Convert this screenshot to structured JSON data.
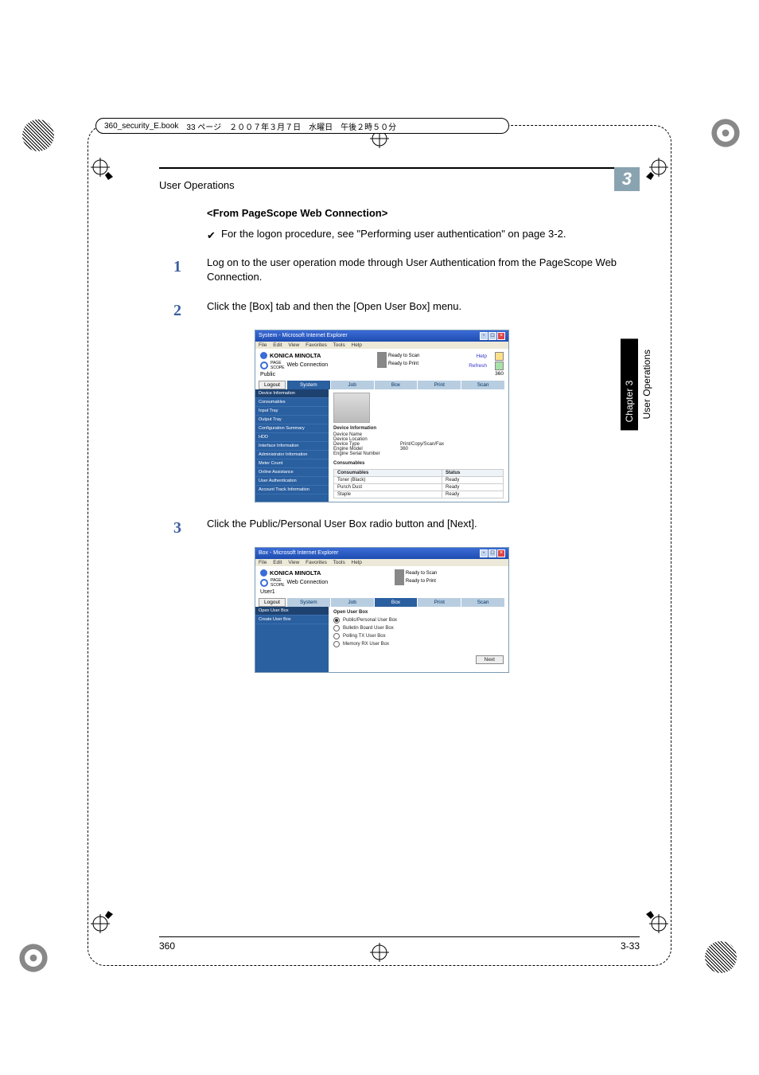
{
  "meta_oval": {
    "filename": "360_security_E.book",
    "page_label": "33 ページ",
    "date": "２００７年３月７日　水曜日　午後２時５０分"
  },
  "chapter": {
    "title": "User Operations",
    "number": "3"
  },
  "section_heading": "<From PageScope Web Connection>",
  "note_text": "For the logon procedure, see \"Performing user authentication\" on page 3-2.",
  "steps": [
    {
      "n": "1",
      "text": "Log on to the user operation mode through User Authentication from the PageScope Web Connection."
    },
    {
      "n": "2",
      "text": "Click the [Box] tab and then the [Open User Box] menu."
    },
    {
      "n": "3",
      "text": "Click the Public/Personal User Box radio button and [Next]."
    }
  ],
  "sidetab": {
    "black": "Chapter 3",
    "plain": "User Operations"
  },
  "footer": {
    "left": "360",
    "right": "3-33"
  },
  "screenshot1": {
    "title": "System - Microsoft Internet Explorer",
    "menus": [
      "File",
      "Edit",
      "View",
      "Favorites",
      "Tools",
      "Help"
    ],
    "brand": "KONICA MINOLTA",
    "brand_sub": "Web Connection",
    "user": "Public",
    "status": [
      "Ready to Scan",
      "Ready to Print"
    ],
    "links": {
      "help": "Help",
      "refresh": "Refresh",
      "model": "360"
    },
    "logout": "Logout",
    "tabs": [
      "System",
      "Job",
      "Box",
      "Print",
      "Scan"
    ],
    "active_tab": 0,
    "side_items": [
      "Device Information",
      "Consumables",
      "Input Tray",
      "Output Tray",
      "Configuration Summary",
      "HDD",
      "Interface Information",
      "Administrator Information",
      "Meter Count",
      "Online Assistance",
      "User Authentication",
      "Account Track Information"
    ],
    "device_info_label": "Device Information",
    "device_rows": [
      {
        "k": "Device Name",
        "v": ""
      },
      {
        "k": "Device Location",
        "v": ""
      },
      {
        "k": "Device Type",
        "v": "Print/Copy/Scan/Fax"
      },
      {
        "k": "Engine Model",
        "v": "360"
      },
      {
        "k": "Engine Serial Number",
        "v": ""
      }
    ],
    "consumables_label": "Consumables",
    "cons_head": {
      "c": "Consumables",
      "s": "Status"
    },
    "cons_rows": [
      {
        "c": "Toner (Black)",
        "s": "Ready"
      },
      {
        "c": "Punch Dust",
        "s": "Ready"
      },
      {
        "c": "Staple",
        "s": "Ready"
      }
    ]
  },
  "screenshot2": {
    "title": "Box - Microsoft Internet Explorer",
    "menus": [
      "File",
      "Edit",
      "View",
      "Favorites",
      "Tools",
      "Help"
    ],
    "brand": "KONICA MINOLTA",
    "brand_sub": "Web Connection",
    "user": "User1",
    "status": [
      "Ready to Scan",
      "Ready to Print"
    ],
    "logout": "Logout",
    "tabs": [
      "System",
      "Job",
      "Box",
      "Print",
      "Scan"
    ],
    "active_tab": 2,
    "side_items": [
      "Open User Box",
      "Create User Box"
    ],
    "open_label": "Open User Box",
    "radios": [
      {
        "label": "Public/Personal User Box",
        "on": true
      },
      {
        "label": "Bulletin Board User Box",
        "on": false
      },
      {
        "label": "Polling TX User Box",
        "on": false
      },
      {
        "label": "Memory RX User Box",
        "on": false
      }
    ],
    "next": "Next"
  }
}
